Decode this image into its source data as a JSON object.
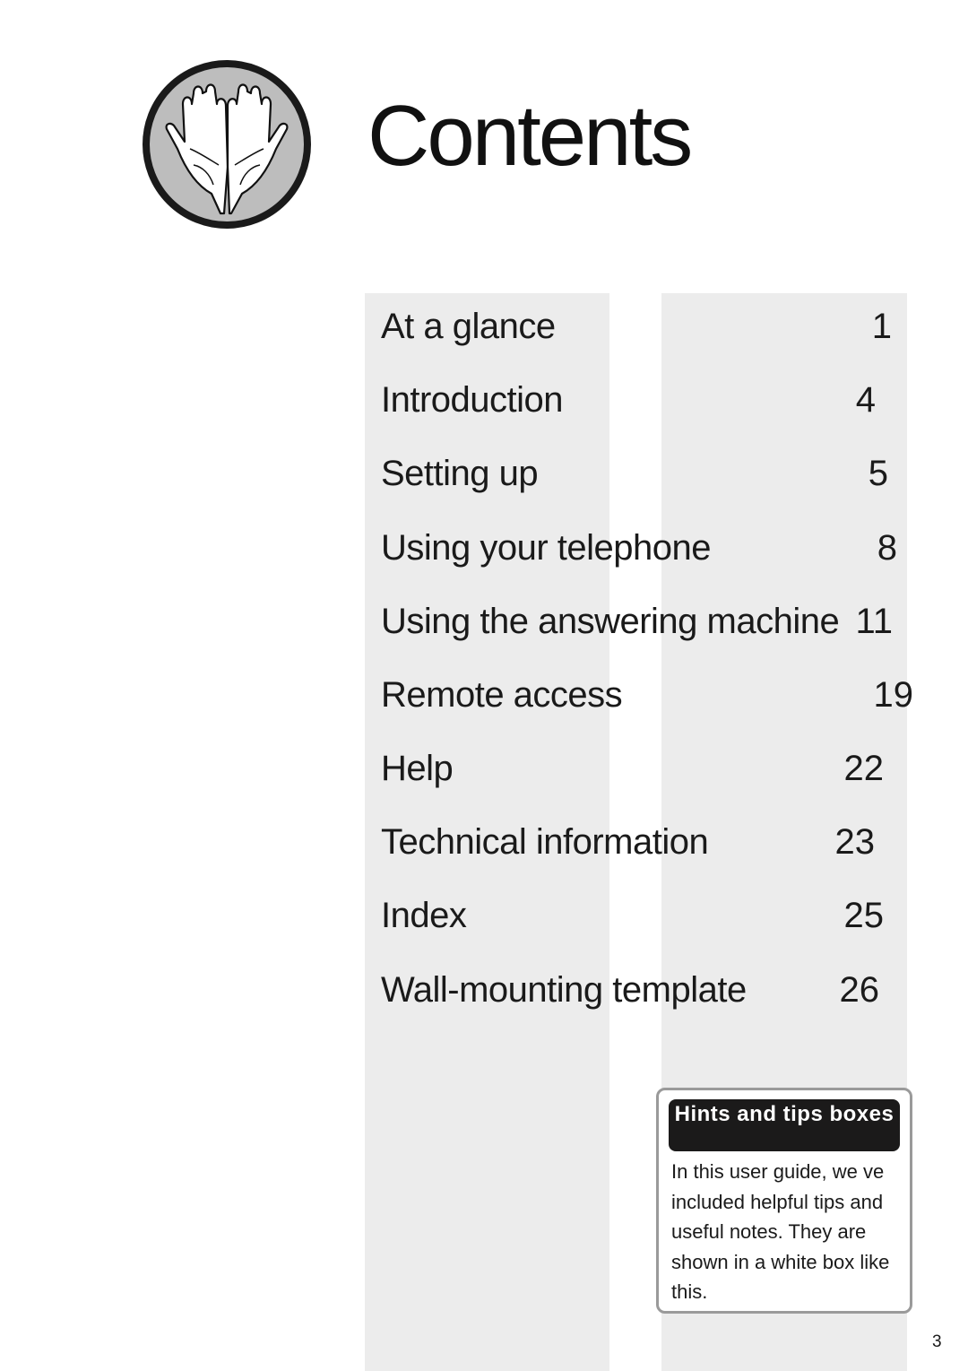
{
  "title": "Contents",
  "logo_icon": "open-hands-icon",
  "toc": [
    {
      "label": "At a glance",
      "page": "1"
    },
    {
      "label": "Introduction",
      "page": "4"
    },
    {
      "label": "Setting up",
      "page": "5"
    },
    {
      "label": "Using your telephone",
      "page": "8"
    },
    {
      "label": "Using the answering machine",
      "page": "11"
    },
    {
      "label": "Remote access",
      "page": "19"
    },
    {
      "label": "Help",
      "page": "22"
    },
    {
      "label": "Technical information",
      "page": "23"
    },
    {
      "label": "Index",
      "page": "25"
    },
    {
      "label": "Wall-mounting template",
      "page": "26"
    }
  ],
  "hints": {
    "heading": "Hints and tips boxes",
    "body": "In this user guide, we ve included helpful tips and useful notes. They are shown in a white box like this."
  },
  "page_number": "3",
  "colors": {
    "band": "#ececec",
    "hints_header": "#1b1a1a",
    "hints_border": "#9a9a9a"
  }
}
